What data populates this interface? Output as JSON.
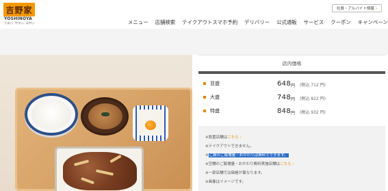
{
  "header": {
    "logo_kanji": "吉野家",
    "logo_en": "YOSHINOYA",
    "logo_tagline": "うまい、やすい、はやい",
    "recruit_label": "社員・アルバイト情報",
    "recruit_arrow": "›",
    "nav": [
      "メニュー",
      "店舗検索",
      "テイクアウトスマホ予約",
      "デリバリー",
      "公式通販",
      "サービス",
      "クーポン",
      "キャンペーン"
    ]
  },
  "price_panel": {
    "title": "店内価格",
    "rows": [
      {
        "size": "並盛",
        "price": "648",
        "yen": "円",
        "tax": "(税込 712 円)"
      },
      {
        "size": "大盛",
        "price": "748",
        "yen": "円",
        "tax": "(税込 822 円)"
      },
      {
        "size": "特盛",
        "price": "848",
        "yen": "円",
        "tax": "(税込 932 円)"
      }
    ]
  },
  "notes": {
    "n1": "※設置店舗は",
    "n1_link": "こちら ›",
    "n2": "※テイクアウトできません。",
    "n3_hl": "ご飯のご飯増量・おかわりは無料でできます。",
    "n4": "※空舗のご飯増量・おかわり無料実施店舗は",
    "n4_link": "こちら ›",
    "n5": "※一部店舗では価格が異なります。",
    "n6": "※画像はイメージです。"
  },
  "colors": {
    "accent": "#e08a00",
    "logo_bg": "#f39800",
    "highlight": "#2f6fc9"
  }
}
